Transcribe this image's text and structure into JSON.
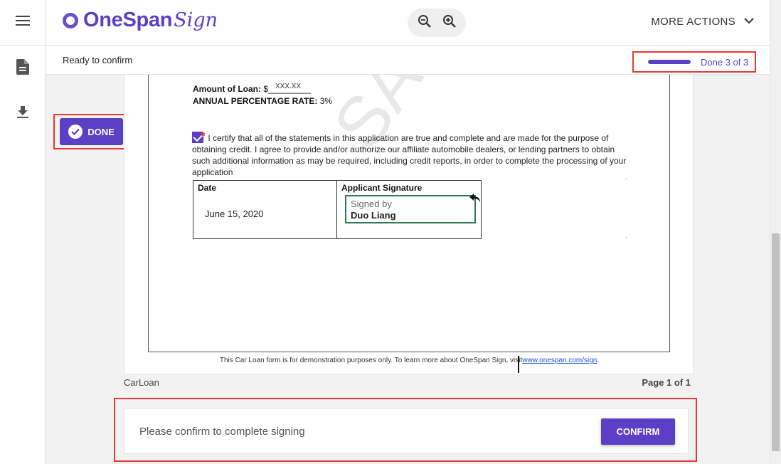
{
  "app": {
    "logo_main": "OneSpan",
    "logo_script": "Sign"
  },
  "header": {
    "more_actions_label": "MORE ACTIONS"
  },
  "status": {
    "text": "Ready to confirm",
    "progress_label": "Done 3 of 3",
    "progress_fraction": 1.0
  },
  "done_button": {
    "label": "DONE"
  },
  "document": {
    "watermark": "SAI",
    "loan_amount_label": "Amount of Loan:",
    "loan_amount_value": "$_________",
    "loan_amount_entry": "XXX.XX",
    "apr_label": "ANNUAL PERCENTAGE RATE:",
    "apr_value": "3%",
    "certify_text": "I certify that all of the statements in this application are true and complete and are made for the purpose of obtaining credit. I agree to provide and/or authorize our affiliate automobile dealers, or lending partners to obtain such additional information as may be required, including credit reports, in order to complete the processing of your application",
    "date_header": "Date",
    "date_value": "June 15, 2020",
    "signature_header": "Applicant Signature",
    "signed_by_label": "Signed by",
    "signer_name": "Duo Liang",
    "footnote_text": "This Car Loan form is for demonstration purposes only. To learn more about OneSpan Sign, visit",
    "footnote_link": "www.onespan.com/sign",
    "footnote_end": ".",
    "name": "CarLoan",
    "page_label": "Page 1 of 1"
  },
  "confirm": {
    "prompt": "Please confirm to complete signing",
    "button_label": "CONFIRM"
  },
  "colors": {
    "brand": "#5b3fc4",
    "highlight": "#e53935",
    "signature_border": "#2e7d4f"
  }
}
